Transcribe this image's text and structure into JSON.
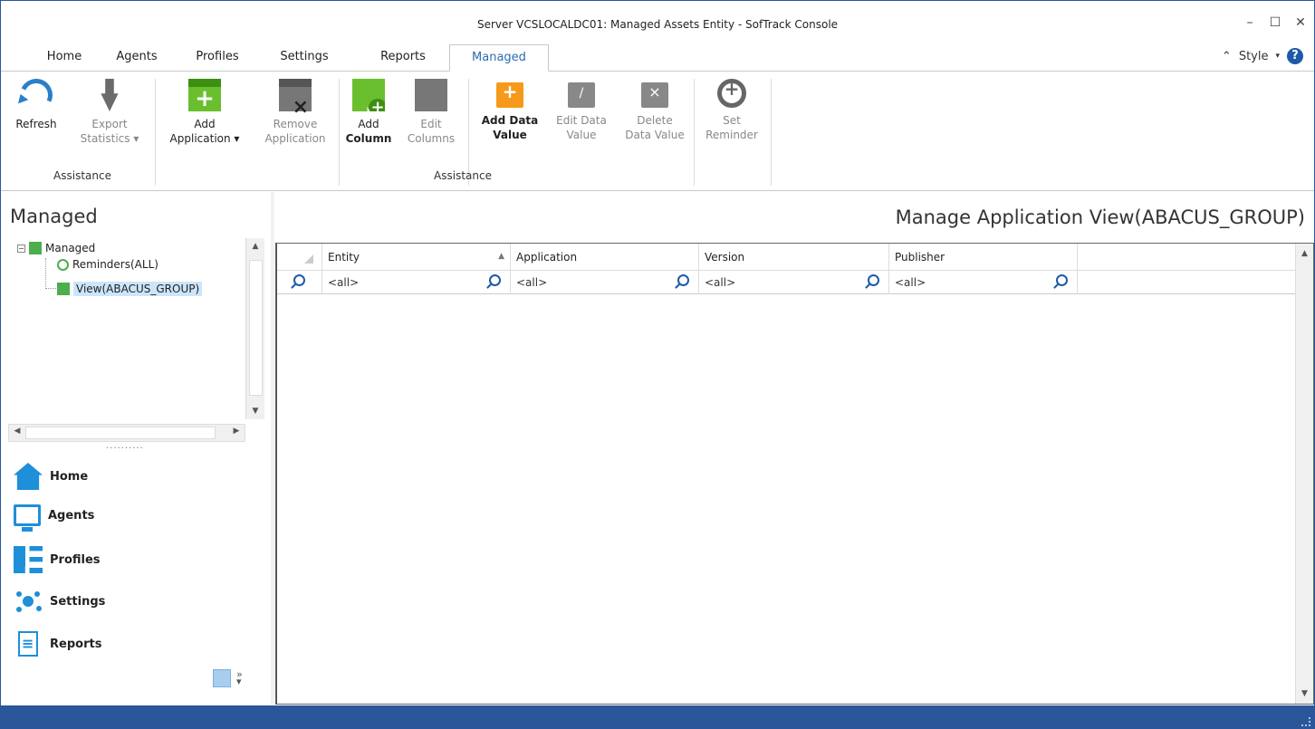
{
  "window": {
    "title": "Server VCSLOCALDC01: Managed Assets Entity - SofTrack Console"
  },
  "tabs": [
    "Home",
    "Agents",
    "Profiles",
    "Settings",
    "Reports",
    "Managed"
  ],
  "active_tab": "Managed",
  "style_menu": {
    "label": "Style"
  },
  "ribbon": {
    "refresh": "Refresh",
    "export_1": "Export",
    "export_2": "Statistics",
    "add_app_1": "Add",
    "add_app_2": "Application",
    "remove_app_1": "Remove",
    "remove_app_2": "Application",
    "add_col_1": "Add",
    "add_col_2": "Column",
    "edit_col_1": "Edit",
    "edit_col_2": "Columns",
    "add_dv_1": "Add Data",
    "add_dv_2": "Value",
    "edit_dv_1": "Edit Data",
    "edit_dv_2": "Value",
    "del_dv_1": "Delete",
    "del_dv_2": "Data Value",
    "set_rem_1": "Set",
    "set_rem_2": "Reminder",
    "group1": "Assistance",
    "group2": "Assistance"
  },
  "left": {
    "title": "Managed",
    "tree": {
      "root": "Managed",
      "reminders": "Reminders(ALL)",
      "view": "View(ABACUS_GROUP)"
    },
    "nav": [
      "Home",
      "Agents",
      "Profiles",
      "Settings",
      "Reports"
    ]
  },
  "main": {
    "title": "Manage Application View(ABACUS_GROUP)",
    "columns": [
      "Entity",
      "Application",
      "Version",
      "Publisher"
    ],
    "filter_placeholder": "<all>",
    "filters": [
      "<all>",
      "<all>",
      "<all>",
      "<all>"
    ]
  },
  "colors": {
    "accent": "#2b579a",
    "tab_active": "#2b6cb0",
    "green": "#6abf2e",
    "orange": "#f59a1a"
  }
}
